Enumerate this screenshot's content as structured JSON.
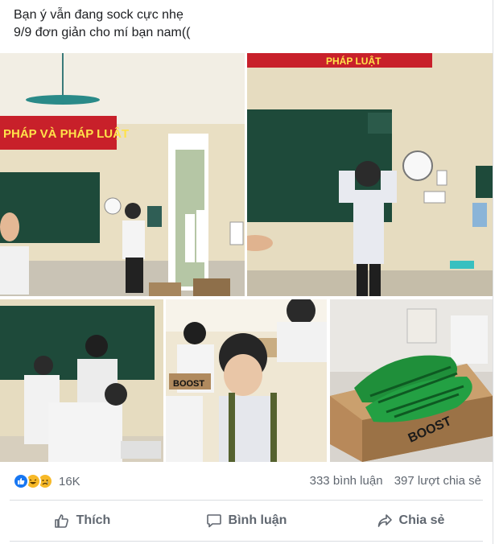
{
  "post": {
    "caption_line1": "Bạn ý vẫn đang sock cực nhẹ",
    "caption_line2": "9/9 đơn giản cho mí bạn nam(("
  },
  "photos": {
    "banner_left": "PHÁP VÀ PHÁP LUẬT",
    "banner_right": "PHÁP LUẬT",
    "box_text": "BOOST"
  },
  "reactions": {
    "icons": [
      "like-icon",
      "haha-icon",
      "sad-icon"
    ],
    "count": "16K",
    "comments": "333 bình luận",
    "shares": "397 lượt chia sẻ"
  },
  "actions": {
    "like": "Thích",
    "comment": "Bình luận",
    "share": "Chia sẻ"
  },
  "colors": {
    "like_blue": "#1877f2",
    "reaction_yellow": "#f7b928",
    "secondary_text": "#606770",
    "divider": "#dadde1",
    "board_green": "#1e4a3a",
    "banner_red": "#c8202a"
  }
}
